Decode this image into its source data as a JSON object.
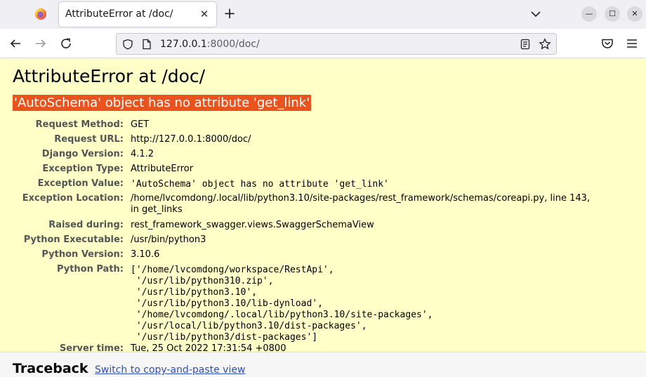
{
  "browser": {
    "tab_title": "AttributeError at /doc/",
    "url_host": "127.0.0.1",
    "url_rest": ":8000/doc/"
  },
  "error": {
    "title": "AttributeError at /doc/",
    "message": "'AutoSchema' object has no attribute 'get_link'"
  },
  "meta": [
    {
      "key": "Request Method:",
      "value": "GET"
    },
    {
      "key": "Request URL:",
      "value": "http://127.0.0.1:8000/doc/"
    },
    {
      "key": "Django Version:",
      "value": "4.1.2"
    },
    {
      "key": "Exception Type:",
      "value": "AttributeError"
    },
    {
      "key": "Exception Value:",
      "value": "'AutoSchema' object has no attribute 'get_link'"
    },
    {
      "key": "Exception Location:",
      "value": "/home/lvcomdong/.local/lib/python3.10/site-packages/rest_framework/schemas/coreapi.py, line 143, in get_links"
    },
    {
      "key": "Raised during:",
      "value": "rest_framework_swagger.views.SwaggerSchemaView"
    },
    {
      "key": "Python Executable:",
      "value": "/usr/bin/python3"
    },
    {
      "key": "Python Version:",
      "value": "3.10.6"
    },
    {
      "key": "Python Path:",
      "value": "['/home/lvcomdong/workspace/RestApi',\n '/usr/lib/python310.zip',\n '/usr/lib/python3.10',\n '/usr/lib/python3.10/lib-dynload',\n '/home/lvcomdong/.local/lib/python3.10/site-packages',\n '/usr/local/lib/python3.10/dist-packages',\n '/usr/lib/python3/dist-packages']"
    },
    {
      "key": "Server time:",
      "value": "Tue, 25 Oct 2022 17:31:54 +0800"
    }
  ],
  "traceback": {
    "title": "Traceback",
    "link": "Switch to copy-and-paste view"
  },
  "colors": {
    "summary_bg": "#ffffc8",
    "error_highlight": "#e9541e",
    "link": "#3150b3"
  }
}
